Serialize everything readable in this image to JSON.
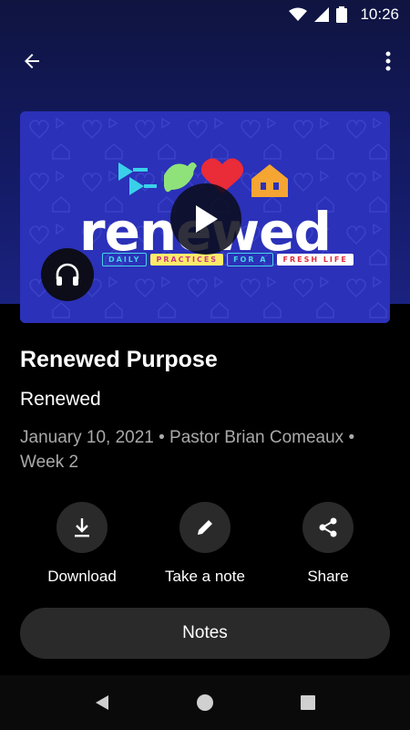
{
  "status_bar": {
    "time": "10:26"
  },
  "episode": {
    "title": "Renewed Purpose",
    "series": "Renewed",
    "meta": "January 10, 2021 • Pastor Brian Comeaux • Week 2"
  },
  "artwork": {
    "wordmark": "renewed",
    "strip": [
      "DAILY",
      "PRACTICES",
      "FOR A",
      "FRESH LIFE"
    ]
  },
  "actions": {
    "download": "Download",
    "note": "Take a note",
    "share": "Share"
  },
  "notes_button": "Notes",
  "colors": {
    "hero_top": "#0f1440",
    "artwork_bg": "#2b31b8",
    "button_bg": "#2a2a2a",
    "meta_text": "#a9a9a9"
  },
  "icons": [
    "back-arrow-icon",
    "more-vert-icon",
    "play-icon",
    "headphones-icon",
    "download-icon",
    "pencil-icon",
    "share-icon"
  ]
}
